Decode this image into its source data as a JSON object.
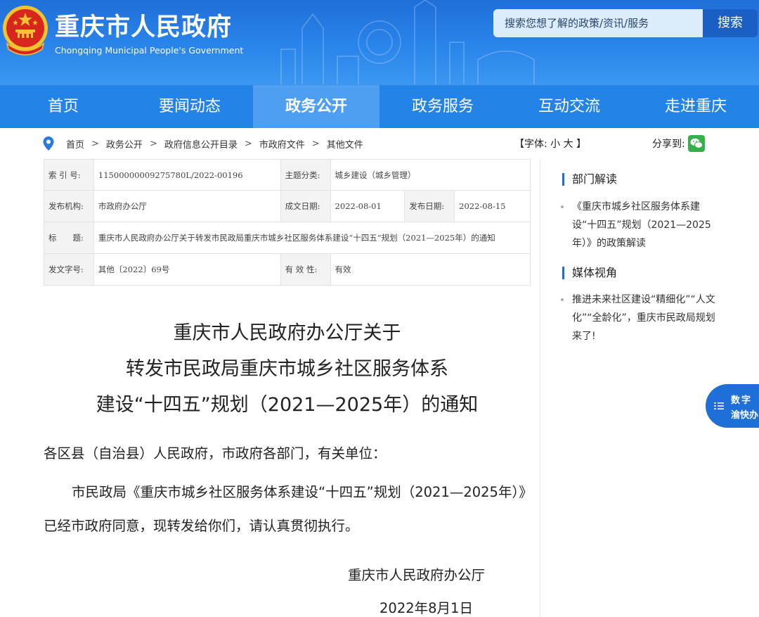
{
  "header": {
    "title": "重庆市人民政府",
    "subtitle": "Chongqing Municipal People's Government",
    "search_placeholder": "搜索您想了解的政策/资讯/服务",
    "search_button": "搜索"
  },
  "nav": {
    "items": [
      {
        "label": "首页"
      },
      {
        "label": "要闻动态"
      },
      {
        "label": "政务公开",
        "active": true
      },
      {
        "label": "政务服务"
      },
      {
        "label": "互动交流"
      },
      {
        "label": "走进重庆"
      }
    ]
  },
  "breadcrumb": {
    "items": [
      "首页",
      "政务公开",
      "政府信息公开目录",
      "市政府文件",
      "其他文件"
    ],
    "separator": ">"
  },
  "font_control": {
    "prefix": "【字体:",
    "small": "小",
    "large": "大",
    "suffix": "】"
  },
  "share": {
    "label": "分享到:"
  },
  "meta": {
    "index_label": "索 引 号:",
    "index_value": "11500000009275780L/2022-00196",
    "topic_label": "主题分类:",
    "topic_value": "城乡建设（城乡管理）",
    "publisher_label": "发布机构:",
    "publisher_value": "市政府办公厅",
    "created_label": "成文日期:",
    "created_value": "2022-08-01",
    "published_label": "发布日期:",
    "published_value": "2022-08-15",
    "title_label": "标　　题:",
    "title_value": "重庆市人民政府办公厅关于转发市民政局重庆市城乡社区服务体系建设“十四五”规划（2021—2025年）的通知",
    "docno_label": "发文字号:",
    "docno_value": "其他〔2022〕69号",
    "validity_label": "有 效 性:",
    "validity_value": "有效"
  },
  "article": {
    "title_line1": "重庆市人民政府办公厅关于",
    "title_line2": "转发市民政局重庆市城乡社区服务体系",
    "title_line3": "建设“十四五”规划（2021—2025年）的通知",
    "greeting": "各区县（自治县）人民政府，市政府各部门，有关单位：",
    "body": "市民政局《重庆市城乡社区服务体系建设“十四五”规划（2021—2025年）》已经市政府同意，现转发给你们，请认真贯彻执行。",
    "signature": "重庆市人民政府办公厅",
    "date": "2022年8月1日"
  },
  "sidebar": {
    "section1_title": "部门解读",
    "section1_link": "《重庆市城乡社区服务体系建设“十四五”规划（2021—2025年）》的政策解读",
    "section2_title": "媒体视角",
    "section2_link": "推进未来社区建设“精细化”“人文化”“全龄化”，重庆市民政局规划来了!"
  },
  "float_button": {
    "line1": "数字",
    "line2": "渝快办"
  },
  "colors": {
    "header_blue": "#2a85ea",
    "nav_blue": "#2383e6",
    "nav_active": "#4e9ff2",
    "search_button": "#1c5fc4",
    "accent": "#1f6fd8",
    "wechat_green": "#35b04a",
    "emblem_red": "#d7261c",
    "emblem_gold": "#f4c430"
  },
  "icons": {
    "emblem": "national-emblem-icon",
    "location": "location-pin-icon",
    "wechat": "wechat-icon",
    "float": "menu-lines-icon"
  }
}
